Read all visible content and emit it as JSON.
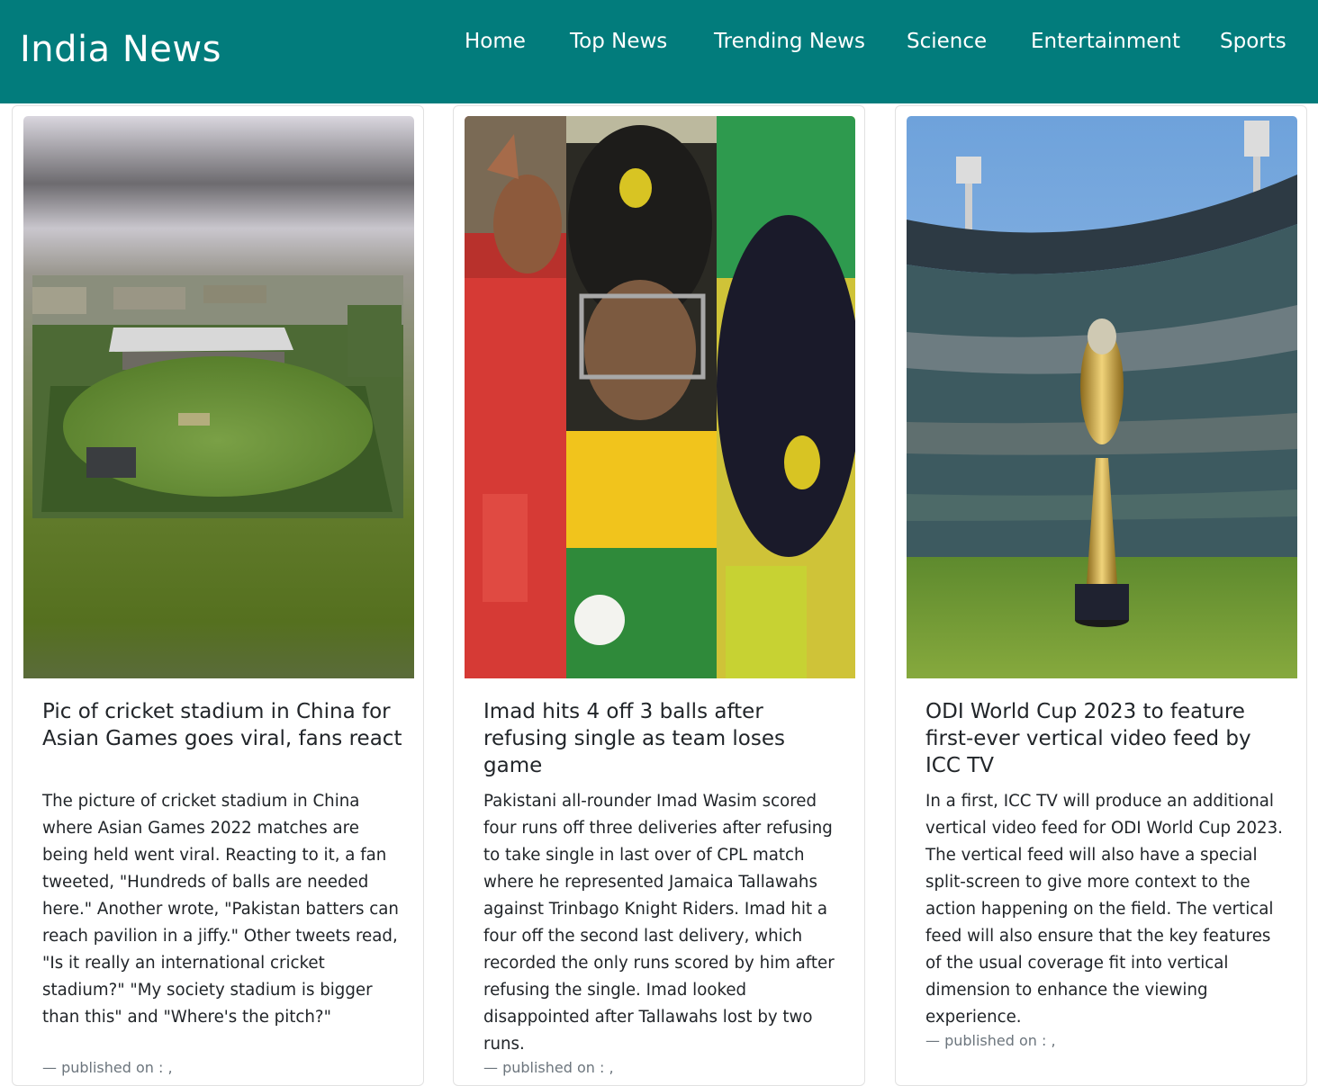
{
  "brand": "India News",
  "nav": {
    "home": "Home",
    "top_news": "Top News",
    "trending_news": "Trending News",
    "science": "Science",
    "entertainment": "Entertainment",
    "sports": "Sports"
  },
  "colors": {
    "navbar_bg": "#027c7c",
    "text": "#212529",
    "muted": "#6c757d"
  },
  "cards": [
    {
      "title": "Pic of cricket stadium in China for Asian Games goes viral, fans react",
      "description": "The picture of cricket stadium in China where Asian Games 2022 matches are being held went viral. Reacting to it, a fan tweeted, \"Hundreds of balls are needed here.\" Another wrote, \"Pakistan batters can reach pavilion in a jiffy.\" Other tweets read, \"Is it really an international cricket stadium?\" \"My society stadium is bigger than this\" and \"Where's the pitch?\"",
      "published": "— published on : ,"
    },
    {
      "title": "Imad hits 4 off 3 balls after refusing single as team loses game",
      "description": "Pakistani all-rounder Imad Wasim scored four runs off three deliveries after refusing to take single in last over of CPL match where he represented Jamaica Tallawahs against Trinbago Knight Riders. Imad hit a four off the second last delivery, which recorded the only runs scored by him after refusing the single. Imad looked disappointed after Tallawahs lost by two runs.",
      "published": "— published on : ,"
    },
    {
      "title": "ODI World Cup 2023 to feature first-ever vertical video feed by ICC TV",
      "description": "In a first, ICC TV will produce an additional vertical video feed for ODI World Cup 2023. The vertical feed will also have a special split-screen to give more context to the action happening on the field. The vertical feed will also ensure that the key features of the usual coverage fit into vertical dimension to enhance the viewing experience.",
      "published": "— published on : ,"
    }
  ]
}
